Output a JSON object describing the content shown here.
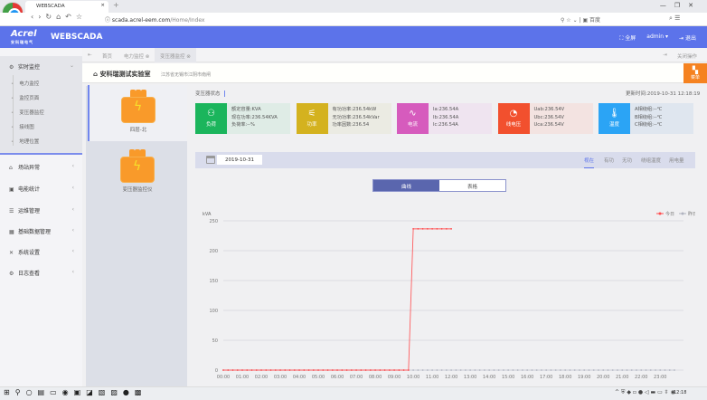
{
  "browser": {
    "tab_title": "WEBSCADA",
    "url_host": "scada.acrel-eem.com",
    "url_path": "/Home/Index",
    "search_engine": "百度"
  },
  "header": {
    "logo_text": "Acrel",
    "logo_sub": "安科瑞电气",
    "app_name": "WEBSCADA",
    "fullscreen_label": "全屏",
    "user": "admin",
    "logout_label": "退出",
    "brand_color": "#5c73ea"
  },
  "sidebar": {
    "items": [
      {
        "label": "实时监控",
        "icon": "monitor-icon",
        "expanded": true,
        "children": [
          "电力监控",
          "监控页面",
          "变压器监控",
          "接线图",
          "地理位置"
        ]
      },
      {
        "label": "场站异常",
        "icon": "alarm-icon"
      },
      {
        "label": "电能统计",
        "icon": "chart-icon"
      },
      {
        "label": "运维管理",
        "icon": "maintenance-icon"
      },
      {
        "label": "基础数据管理",
        "icon": "calendar-icon"
      },
      {
        "label": "系统设置",
        "icon": "tools-icon"
      },
      {
        "label": "日志查看",
        "icon": "log-icon"
      }
    ]
  },
  "page_tabs": {
    "items": [
      "首页",
      "电力监控",
      "变压器监控"
    ],
    "active": 2,
    "close_ops": "关闭操作"
  },
  "page": {
    "title": "安科瑞测试实验室",
    "address": "江苏省无锡市江阴市南闸",
    "menu_label": "菜单"
  },
  "devices": [
    {
      "label": "四层-北",
      "selected": true
    },
    {
      "label": "变压器监控仪"
    }
  ],
  "status": {
    "title": "变压器状态",
    "update_time": "更新时间:2019-10-31 12:18:19",
    "cards": [
      {
        "name": "负荷",
        "color": "#1bb55c",
        "bg": "#dfece6",
        "lines": [
          "额定容量:KVA",
          "现在功率:236.54KVA",
          "负荷率:--%"
        ]
      },
      {
        "name": "功率",
        "color": "#d4b21f",
        "bg": "#ebebe3",
        "lines": [
          "有功功率:236.54kW",
          "无功功率:236.54kVar",
          "功率因数:236.54"
        ]
      },
      {
        "name": "电流",
        "color": "#d65bbd",
        "bg": "#efe4f0",
        "lines": [
          "Ia:236.54A",
          "Ib:236.54A",
          "Ic:236.54A"
        ]
      },
      {
        "name": "线电压",
        "color": "#f2502e",
        "bg": "#f3e3e1",
        "lines": [
          "Uab:236.54V",
          "Ubc:236.54V",
          "Uca:236.54V"
        ]
      },
      {
        "name": "温度",
        "color": "#2ba4f5",
        "bg": "#dfe6ef",
        "lines": [
          "A相绕组:--℃",
          "B相绕组:--℃",
          "C相绕组:--℃"
        ]
      }
    ]
  },
  "toolbar": {
    "date": "2019-10-31",
    "tabs": [
      "视在",
      "有功",
      "无功",
      "绕组温度",
      "用电量"
    ],
    "active": 0
  },
  "view_toggle": {
    "options": [
      "曲线",
      "表格"
    ],
    "active": 0
  },
  "chart_data": {
    "type": "line",
    "ylabel": "kVA",
    "ylim": [
      0,
      250
    ],
    "yticks": [
      0,
      50,
      100,
      150,
      200,
      250
    ],
    "xticks": [
      "00:00",
      "01:00",
      "02:00",
      "03:00",
      "04:00",
      "05:00",
      "06:00",
      "07:00",
      "08:00",
      "09:00",
      "10:00",
      "11:00",
      "12:00",
      "13:00",
      "14:00",
      "15:00",
      "16:00",
      "17:00",
      "18:00",
      "19:00",
      "20:00",
      "21:00",
      "22:00",
      "23:00"
    ],
    "interval_minutes": 15,
    "legend_position": "top-right",
    "grid": true,
    "series": [
      {
        "name": "今日",
        "color": "#ff4d4f",
        "values": [
          0,
          0,
          0,
          0,
          0,
          0,
          0,
          0,
          0,
          0,
          0,
          0,
          0,
          0,
          0,
          0,
          0,
          0,
          0,
          0,
          0,
          0,
          0,
          0,
          0,
          0,
          0,
          0,
          0,
          0,
          0,
          0,
          0,
          0,
          0,
          0,
          0,
          0,
          0,
          0,
          236.54,
          236.54,
          236.54,
          236.54,
          236.54,
          236.54,
          236.54,
          236.54,
          236.54
        ]
      },
      {
        "name": "昨日",
        "color": "#b0b4c0",
        "values": [
          0,
          0,
          0,
          0,
          0,
          0,
          0,
          0,
          0,
          0,
          0,
          0,
          0,
          0,
          0,
          0,
          0,
          0,
          0,
          0,
          0,
          0,
          0,
          0,
          0,
          0,
          0,
          0,
          0,
          0,
          0,
          0,
          0,
          0,
          0,
          0,
          0,
          0,
          0,
          0,
          0,
          0,
          0,
          0,
          0,
          0,
          0,
          0,
          0,
          0,
          0,
          0,
          0,
          0,
          0,
          0,
          0,
          0,
          0,
          0,
          0,
          0,
          0,
          0,
          0,
          0,
          0,
          0,
          0,
          0,
          0,
          0,
          0,
          0,
          0,
          0,
          0,
          0,
          0,
          0,
          0,
          0,
          0,
          0,
          0,
          0,
          0,
          0,
          0,
          0,
          0,
          0,
          0,
          0,
          0,
          0
        ]
      }
    ]
  },
  "taskbar": {
    "time": "12:18"
  }
}
